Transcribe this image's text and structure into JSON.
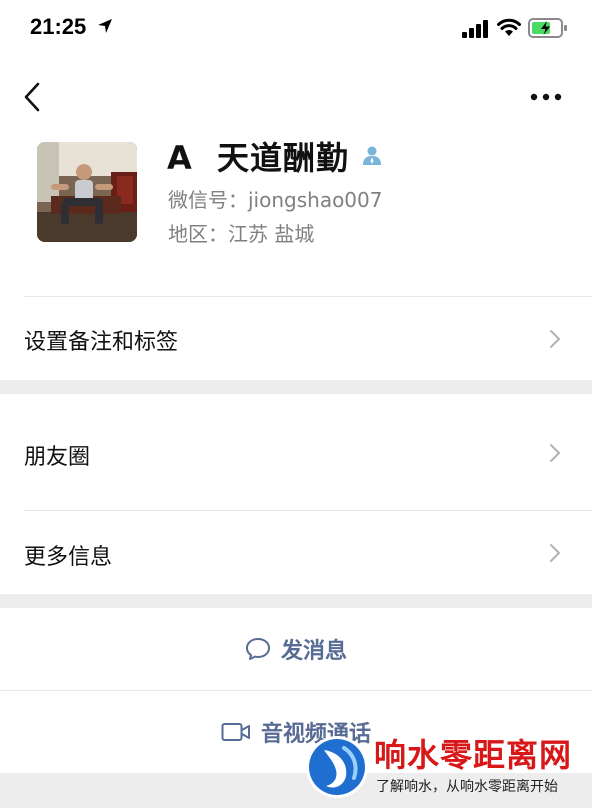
{
  "status_bar": {
    "time": "21:25"
  },
  "profile": {
    "name": "A  天道酬勤",
    "wechat_id": "微信号：jiongshao007",
    "region": "地区：江苏 盐城"
  },
  "menu": {
    "remarks_label": "设置备注和标签",
    "moments_label": "朋友圈",
    "more_info_label": "更多信息"
  },
  "actions": {
    "message_label": "发消息",
    "call_label": "音视频通话"
  },
  "watermark": {
    "title": "响水零距离网",
    "subtitle": "了解响水，从响水零距离开始"
  },
  "colors": {
    "link_blue": "#576b95",
    "gray_text": "#808080",
    "section_gap": "#ededed",
    "battery_green": "#4cd964",
    "watermark_red": "#d81818"
  },
  "icons": [
    "location-arrow-icon",
    "signal-icon",
    "wifi-icon",
    "battery-charging-icon",
    "back-icon",
    "more-icon",
    "person-icon",
    "chevron-right-icon",
    "chat-bubble-icon",
    "video-camera-icon",
    "watermark-logo"
  ]
}
